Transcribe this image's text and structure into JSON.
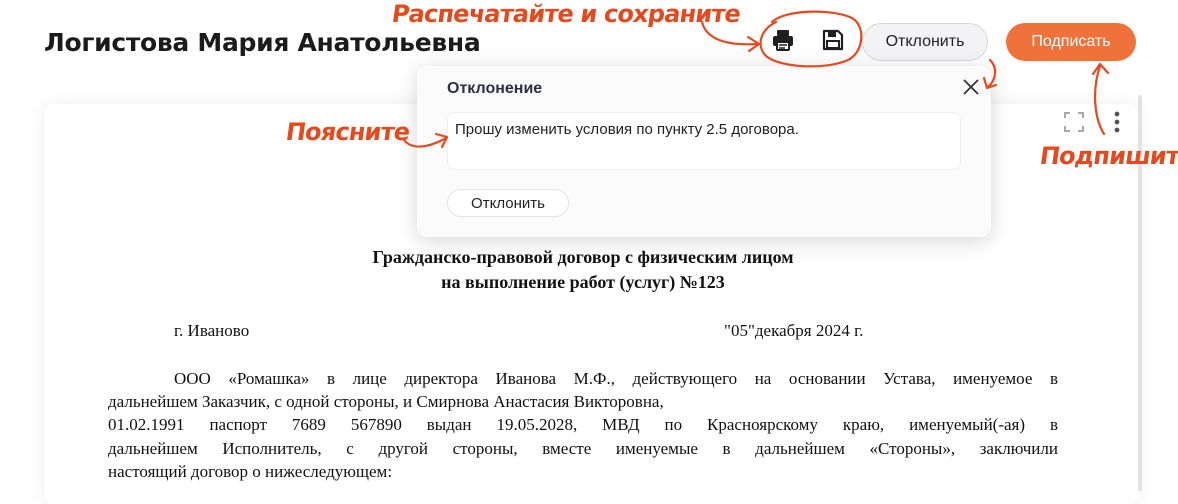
{
  "header": {
    "title": "Логистова Мария Анатольевна",
    "reject_label": "Отклонить",
    "sign_label": "Подписать",
    "accent_color": "#f0723b"
  },
  "dialog": {
    "title": "Отклонение",
    "textarea_value": "Прошу изменить условия по пункту 2.5 договора.",
    "reject_label": "Отклонить"
  },
  "document": {
    "heading_line1": "Гражданско-правовой договор с физическим лицом",
    "heading_line2": "на выполнение работ (услуг) №123",
    "city": "г. Иваново",
    "date": "\"05\"декабря 2024 г.",
    "paragraph_lines": [
      "ООО «Ромашка» в лице директора Иванова М.Ф., действующего на основании Устава, именуемое в",
      "дальнейшем Заказчик, с одной стороны, и Смирнова Анастасия Викторовна,",
      "01.02.1991 паспорт 7689 567890 выдан 19.05.2028, МВД по Красноярскому краю, именуемый(-ая) в",
      "дальнейшем Исполнитель, с другой стороны, вместе именуемые в дальнейшем «Стороны», заключили",
      "настоящий договор о нижеследующем:"
    ]
  },
  "annotations": {
    "print_save": "Распечатайте и сохраните",
    "explain": "Поясните",
    "sign": "Подпишите",
    "color": "#e5491e"
  },
  "icons": [
    "print-icon",
    "save-icon",
    "close-icon",
    "expand-icon",
    "more-vertical-icon"
  ]
}
